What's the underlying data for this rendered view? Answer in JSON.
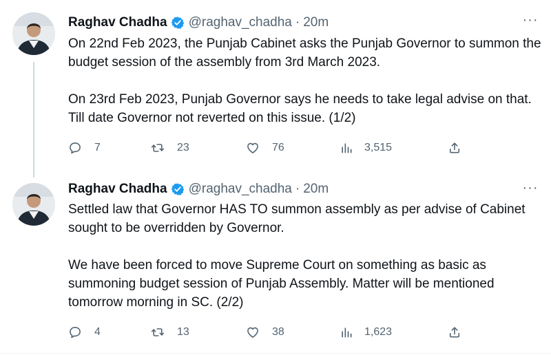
{
  "tweets": [
    {
      "author": {
        "name": "Raghav Chadha",
        "handle": "@raghav_chadha",
        "verified": true,
        "avatar_icon": "profile-photo"
      },
      "separator": "·",
      "time": "20m",
      "more_icon": "···",
      "paragraphs": [
        "On 22nd Feb 2023, the Punjab Cabinet asks the Punjab Governor to summon the budget session of the assembly from 3rd March 2023.",
        "On 23rd Feb 2023, Punjab Governor says he needs to take legal advise on that. Till date Governor not reverted on this issue.  (1/2)"
      ],
      "stats": {
        "replies": "7",
        "retweets": "23",
        "likes": "76",
        "views": "3,515"
      }
    },
    {
      "author": {
        "name": "Raghav Chadha",
        "handle": "@raghav_chadha",
        "verified": true,
        "avatar_icon": "profile-photo"
      },
      "separator": "·",
      "time": "20m",
      "more_icon": "···",
      "paragraphs": [
        "Settled law that Governor HAS TO summon assembly as per advise of Cabinet sought to be overridden by Governor.",
        "We have been forced to move Supreme Court on something as basic as summoning budget session of Punjab Assembly. Matter will be mentioned tomorrow morning in SC. (2/2)"
      ],
      "stats": {
        "replies": "4",
        "retweets": "13",
        "likes": "38",
        "views": "1,623"
      }
    }
  ],
  "colors": {
    "text_primary": "#0f1419",
    "text_secondary": "#536471",
    "verified_badge": "#1d9bf0",
    "thread_line": "#cfd9de"
  }
}
